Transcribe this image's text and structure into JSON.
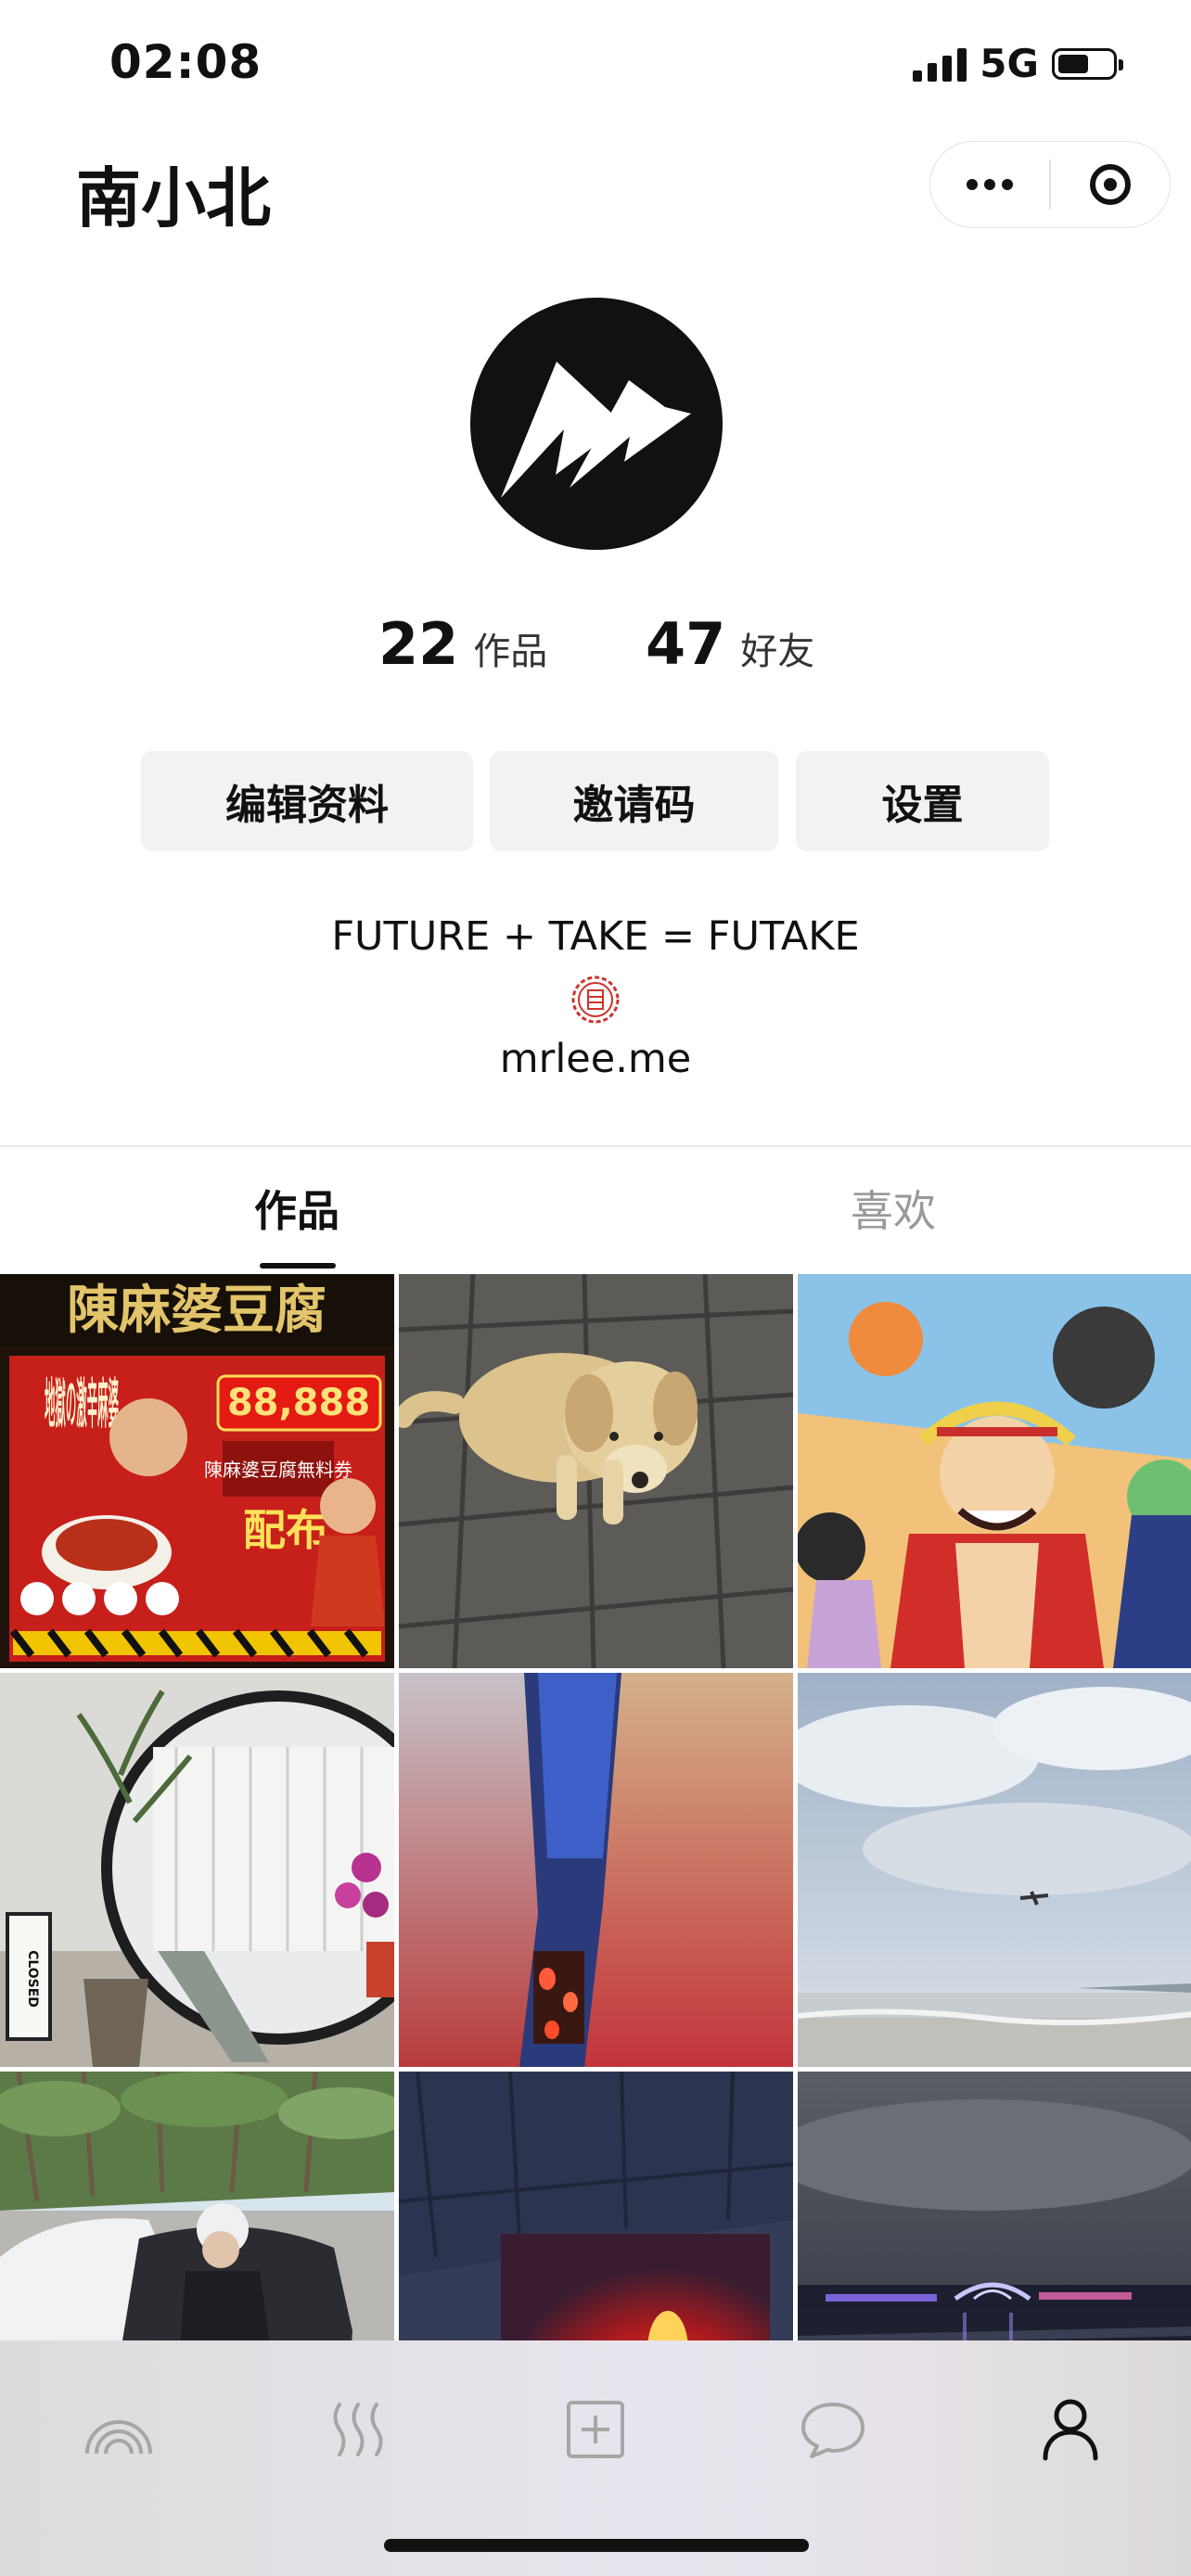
{
  "status_bar": {
    "time": "02:08",
    "network": "5G"
  },
  "header": {
    "name": "南小北"
  },
  "stats": [
    {
      "value": "22",
      "label": "作品"
    },
    {
      "value": "47",
      "label": "好友"
    }
  ],
  "actions": {
    "edit": "编辑资料",
    "invite": "邀请码",
    "settings": "设置"
  },
  "bio": {
    "text": "FUTURE + TAKE = FUTAKE",
    "website": "mrlee.me"
  },
  "tabs": [
    {
      "label": "作品",
      "active": true
    },
    {
      "label": "喜欢",
      "active": false
    }
  ],
  "posts": [
    {
      "subject": "Chen Mapo Tofu restaurant poster",
      "poster": {
        "heading": "陳麻婆豆腐",
        "side": "地獄の激辛麻婆",
        "number": "88,888",
        "sub": "陳麻婆豆腐無料券",
        "cta": "配布"
      }
    },
    {
      "subject": "golden puppy on stone pavement"
    },
    {
      "subject": "One Piece anime artwork"
    },
    {
      "subject": "moon gate interior with CLOSED sign",
      "sign": "CLOSED"
    },
    {
      "subject": "narrow alley with red lanterns at dusk"
    },
    {
      "subject": "cloudy sky over beach with airplane"
    },
    {
      "subject": "person by white car under palm trees"
    },
    {
      "subject": "concert stage with red lights"
    },
    {
      "subject": "city waterfront at night with lit bridge"
    }
  ],
  "bottom_nav": [
    {
      "icon": "rainbow-icon",
      "active": false
    },
    {
      "icon": "heat-waves-icon",
      "active": false
    },
    {
      "icon": "plus-square-icon",
      "active": false
    },
    {
      "icon": "chat-bubble-icon",
      "active": false
    },
    {
      "icon": "person-icon",
      "active": true
    }
  ],
  "colors": {
    "accent": "#111111",
    "button_bg": "#f2f2f2",
    "inactive_tab": "#999999",
    "seal_red": "#d0322d"
  }
}
